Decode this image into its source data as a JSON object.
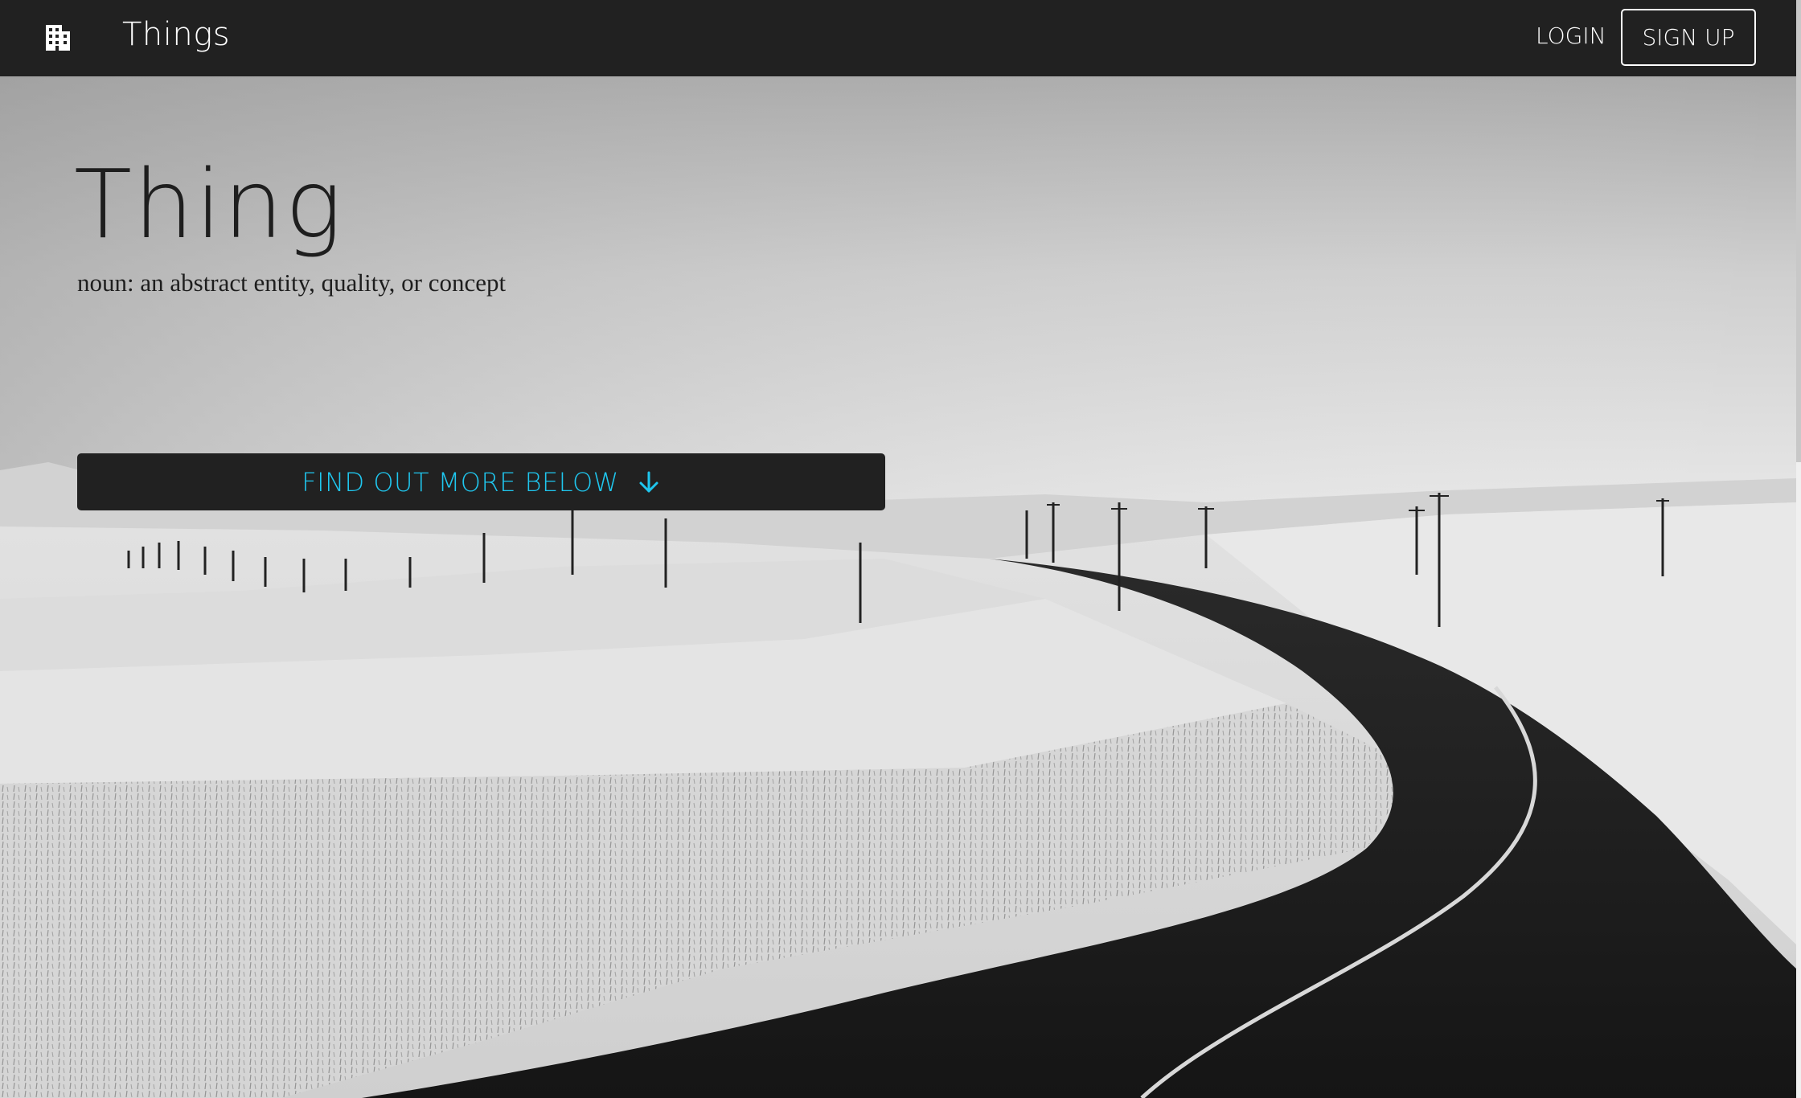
{
  "navbar": {
    "brand_icon": "building-icon",
    "brand_title": "Things",
    "login_label": "LOGIN",
    "signup_label": "SIGN UP"
  },
  "hero": {
    "background": "black-and-white photo of a snowy field with a winding road and power line poles",
    "title": "Thing",
    "subtitle": "noun: an abstract entity, quality, or concept",
    "cta_label": "FIND OUT MORE BELOW",
    "cta_icon": "arrow-down-icon"
  },
  "colors": {
    "navbar_bg": "#212121",
    "accent": "#1fc6ee",
    "text_dark": "#1e1e1e",
    "text_light": "#ffffff"
  }
}
